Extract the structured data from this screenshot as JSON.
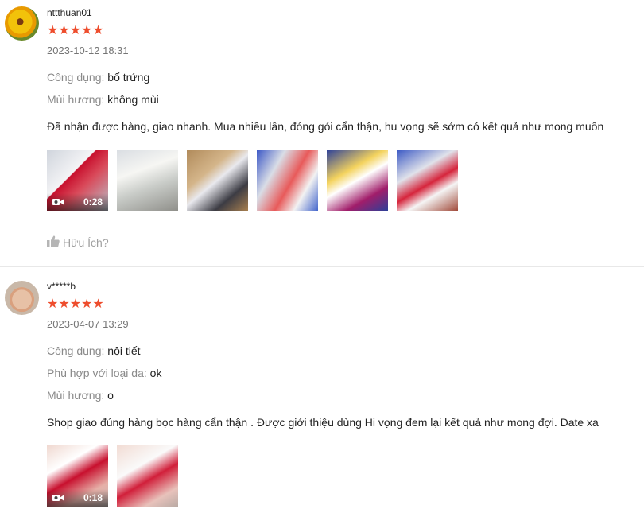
{
  "reviews": [
    {
      "username": "nttthuan01",
      "stars": "★★★★★",
      "rating": 5,
      "time": "2023-10-12 18:31",
      "attributes": [
        {
          "key": "Công dụng:",
          "value": "bổ trứng"
        },
        {
          "key": "Mùi hương:",
          "value": "không mùi"
        }
      ],
      "comment": "Đã nhận được hàng, giao nhanh. Mua nhiều lần, đóng gói cẩn thận, hu vọng sẽ sớm có kết quả như mong muốn",
      "video_duration": "0:28",
      "helpful_label": "Hữu Ích?"
    },
    {
      "username": "v*****b",
      "stars": "★★★★★",
      "rating": 5,
      "time": "2023-04-07 13:29",
      "attributes": [
        {
          "key": "Công dụng:",
          "value": "nội tiết"
        },
        {
          "key": "Phù hợp với loại da:",
          "value": "ok"
        },
        {
          "key": "Mùi hương:",
          "value": "o"
        }
      ],
      "comment": "Shop giao đúng hàng bọc hàng cẩn thận . Được giới thiệu dùng Hi vọng đem lại kết quả như mong đợi. Date xa",
      "video_duration": "0:18"
    }
  ],
  "icons": {
    "camera": "video-camera-icon",
    "thumb": "thumbs-up-icon"
  },
  "colors": {
    "star": "#ee4d2d",
    "muted": "#8a8a8a"
  }
}
